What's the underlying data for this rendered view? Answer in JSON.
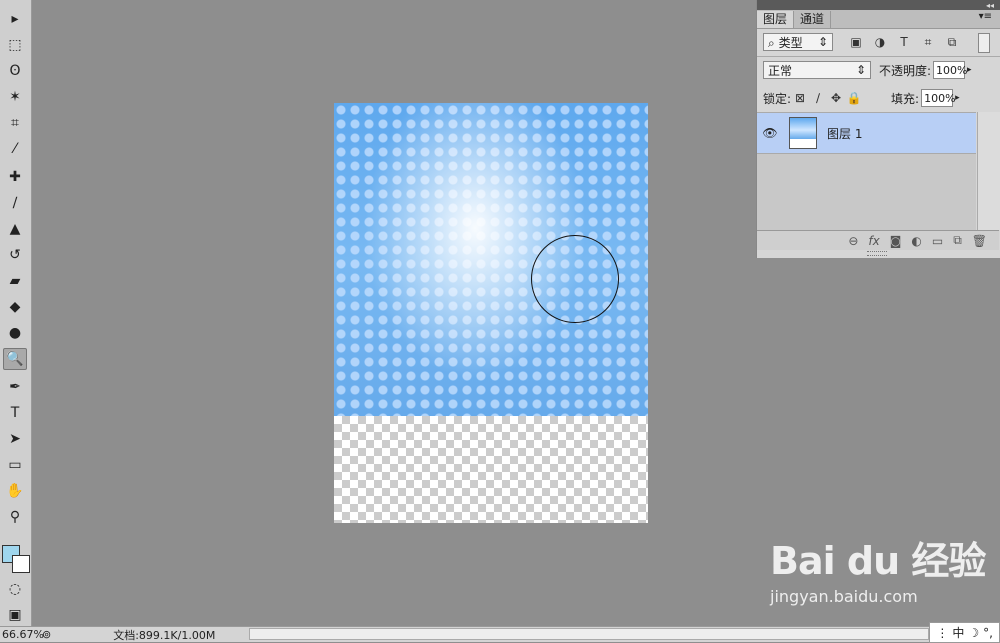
{
  "toolbar": {
    "tools": [
      {
        "name": "move-tool-icon",
        "glyph": "▸"
      },
      {
        "name": "marquee-tool-icon",
        "glyph": "⬚"
      },
      {
        "name": "lasso-tool-icon",
        "glyph": "ʘ"
      },
      {
        "name": "magic-wand-tool-icon",
        "glyph": "✶"
      },
      {
        "name": "crop-tool-icon",
        "glyph": "⌗"
      },
      {
        "name": "eyedropper-tool-icon",
        "glyph": "⁄"
      },
      {
        "name": "healing-brush-tool-icon",
        "glyph": "✚"
      },
      {
        "name": "brush-tool-icon",
        "glyph": "∕"
      },
      {
        "name": "clone-stamp-tool-icon",
        "glyph": "▲"
      },
      {
        "name": "history-brush-tool-icon",
        "glyph": "↺"
      },
      {
        "name": "eraser-tool-icon",
        "glyph": "▰"
      },
      {
        "name": "paint-bucket-tool-icon",
        "glyph": "◆"
      },
      {
        "name": "blur-tool-icon",
        "glyph": "●"
      },
      {
        "name": "dodge-tool-icon",
        "glyph": "🔍"
      },
      {
        "name": "pen-tool-icon",
        "glyph": "✒"
      },
      {
        "name": "type-tool-icon",
        "glyph": "T"
      },
      {
        "name": "path-selection-tool-icon",
        "glyph": "➤"
      },
      {
        "name": "rectangle-tool-icon",
        "glyph": "▭"
      },
      {
        "name": "hand-tool-icon",
        "glyph": "✋"
      },
      {
        "name": "zoom-tool-icon",
        "glyph": "⚲"
      }
    ],
    "active_tool": "dodge-tool-icon"
  },
  "layers_panel": {
    "tabs": [
      "图层",
      "通道"
    ],
    "kind_filter": "类型",
    "blend_mode": "正常",
    "opacity_label": "不透明度:",
    "opacity_value": "100%",
    "lock_label": "锁定:",
    "fill_label": "填充:",
    "fill_value": "100%",
    "layers": [
      {
        "name": "图层 1",
        "visible": true,
        "selected": true
      }
    ],
    "bottom_icons": [
      "link-icon",
      "fx-icon",
      "mask-icon",
      "adjustment-icon",
      "folder-icon",
      "new-layer-icon",
      "trash-icon"
    ]
  },
  "statusbar": {
    "zoom": "66.67%",
    "doc_info": "文档:899.1K/1.00M"
  },
  "ime": {
    "mode": "中"
  },
  "watermark": {
    "logo": "Bai du 经验",
    "url": "jingyan.baidu.com"
  },
  "colors": {
    "foreground": "#9fd6ee",
    "background": "#ffffff",
    "selected_layer_bg": "#b8cff5"
  }
}
